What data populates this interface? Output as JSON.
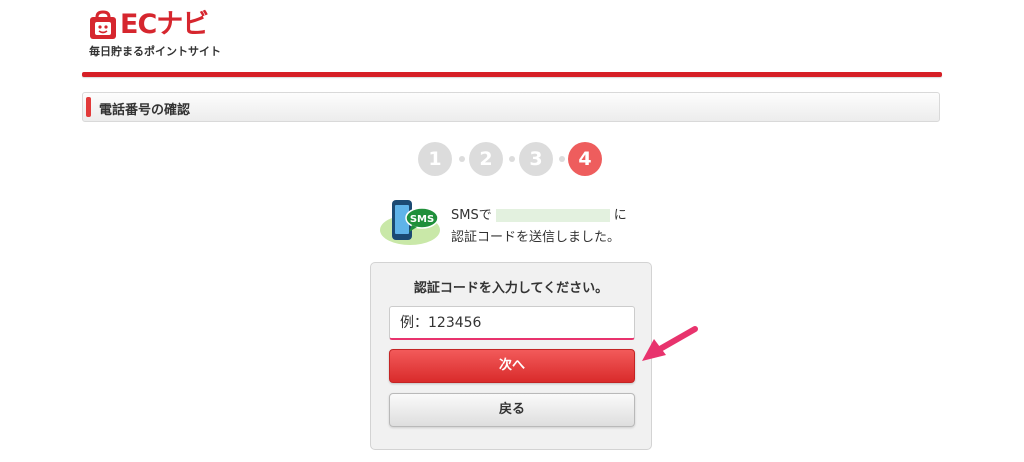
{
  "header": {
    "logo_text": "ECナビ",
    "tagline": "毎日貯まるポイントサイト"
  },
  "section": {
    "title": "電話番号の確認"
  },
  "steps": {
    "items": [
      "1",
      "2",
      "3",
      "4"
    ],
    "current": 4
  },
  "sms_notice": {
    "prefix": "SMSで",
    "suffix": "に",
    "line2": "認証コードを送信しました。",
    "icon_label": "SMS"
  },
  "form": {
    "heading": "認証コードを入力してください。",
    "code_placeholder": "例：123456",
    "code_value": "",
    "next_label": "次へ",
    "back_label": "戻る"
  },
  "colors": {
    "brand_red": "#d61f26",
    "step_active": "#ee5d5d",
    "step_inactive": "#dcdcdc",
    "pointer_pink": "#e8336d"
  }
}
